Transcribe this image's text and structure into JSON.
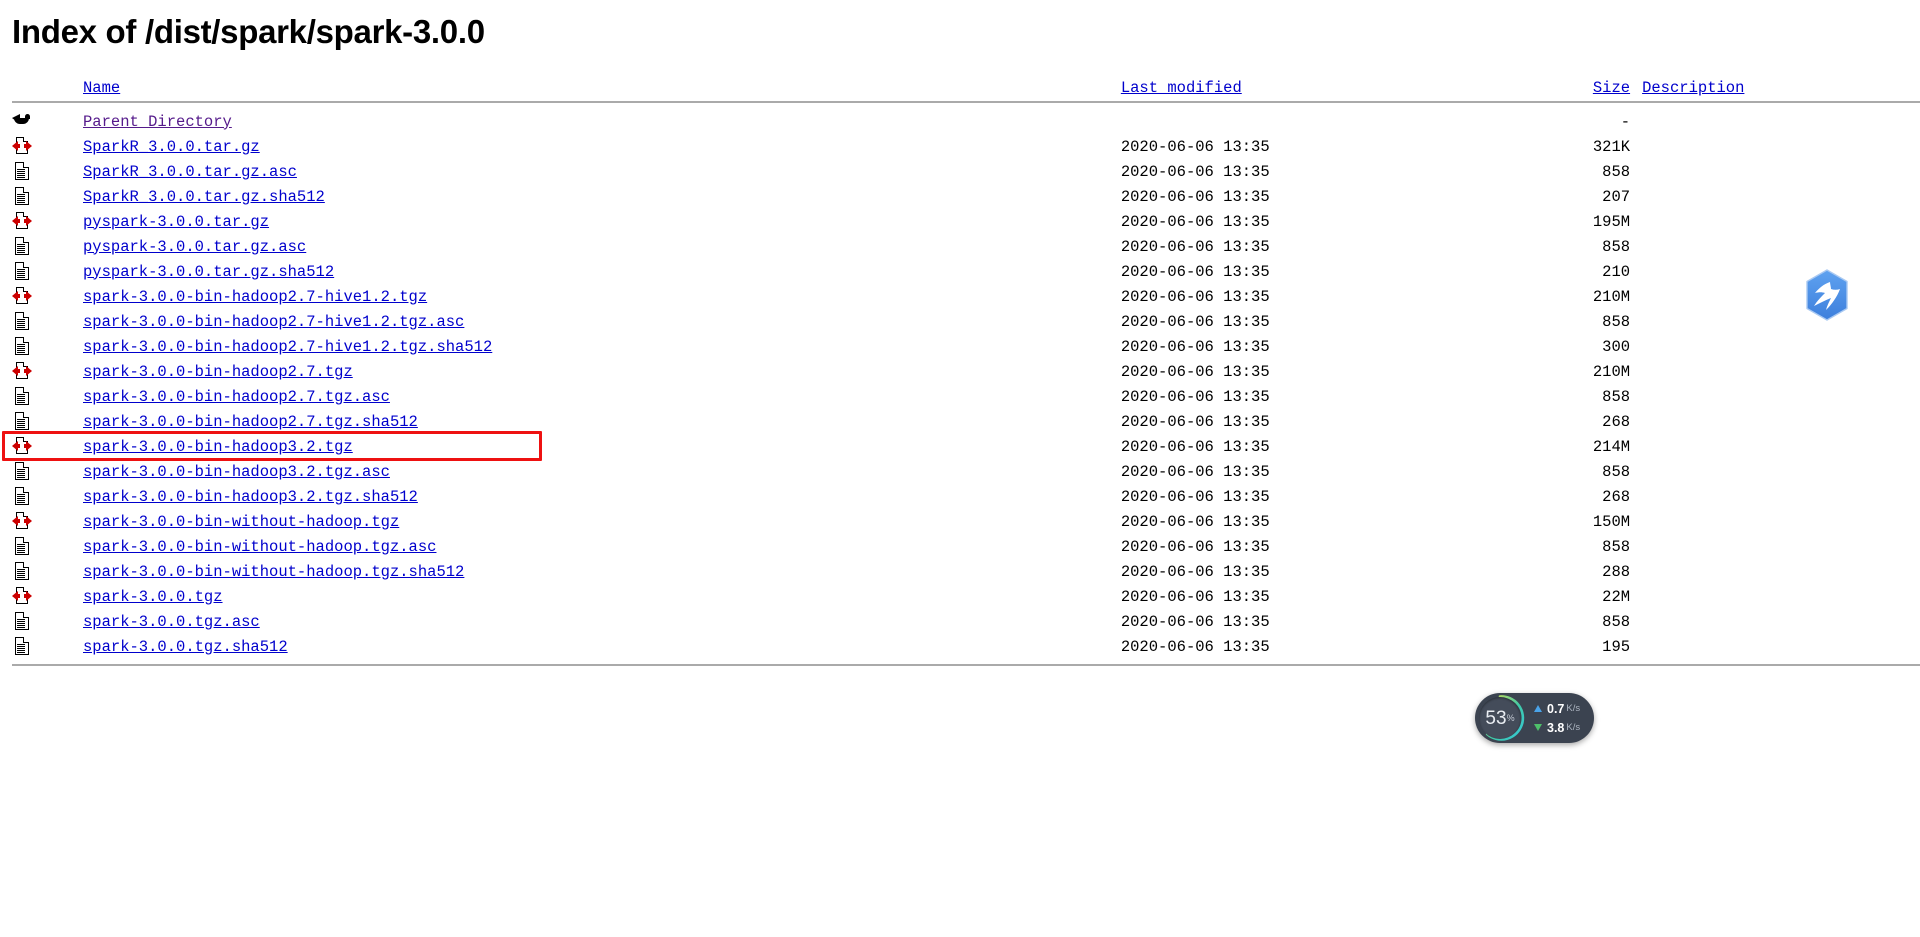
{
  "page": {
    "title": "Index of /dist/spark/spark-3.0.0"
  },
  "columns": {
    "name": "Name",
    "last_modified": "Last modified",
    "size": "Size",
    "description": "Description"
  },
  "parent": {
    "icon": "back-arrow-icon",
    "label": "Parent Directory",
    "last_modified": "",
    "size": "-",
    "description": ""
  },
  "rows": [
    {
      "icon": "archive-icon",
      "name": "SparkR_3.0.0.tar.gz",
      "last_modified": "2020-06-06 13:35",
      "size": "321K",
      "description": ""
    },
    {
      "icon": "text-file-icon",
      "name": "SparkR_3.0.0.tar.gz.asc",
      "last_modified": "2020-06-06 13:35",
      "size": "858",
      "description": ""
    },
    {
      "icon": "text-file-icon",
      "name": "SparkR_3.0.0.tar.gz.sha512",
      "last_modified": "2020-06-06 13:35",
      "size": "207",
      "description": ""
    },
    {
      "icon": "archive-icon",
      "name": "pyspark-3.0.0.tar.gz",
      "last_modified": "2020-06-06 13:35",
      "size": "195M",
      "description": ""
    },
    {
      "icon": "text-file-icon",
      "name": "pyspark-3.0.0.tar.gz.asc",
      "last_modified": "2020-06-06 13:35",
      "size": "858",
      "description": ""
    },
    {
      "icon": "text-file-icon",
      "name": "pyspark-3.0.0.tar.gz.sha512",
      "last_modified": "2020-06-06 13:35",
      "size": "210",
      "description": ""
    },
    {
      "icon": "archive-icon",
      "name": "spark-3.0.0-bin-hadoop2.7-hive1.2.tgz",
      "last_modified": "2020-06-06 13:35",
      "size": "210M",
      "description": ""
    },
    {
      "icon": "text-file-icon",
      "name": "spark-3.0.0-bin-hadoop2.7-hive1.2.tgz.asc",
      "last_modified": "2020-06-06 13:35",
      "size": "858",
      "description": ""
    },
    {
      "icon": "text-file-icon",
      "name": "spark-3.0.0-bin-hadoop2.7-hive1.2.tgz.sha512",
      "last_modified": "2020-06-06 13:35",
      "size": "300",
      "description": ""
    },
    {
      "icon": "archive-icon",
      "name": "spark-3.0.0-bin-hadoop2.7.tgz",
      "last_modified": "2020-06-06 13:35",
      "size": "210M",
      "description": ""
    },
    {
      "icon": "text-file-icon",
      "name": "spark-3.0.0-bin-hadoop2.7.tgz.asc",
      "last_modified": "2020-06-06 13:35",
      "size": "858",
      "description": ""
    },
    {
      "icon": "text-file-icon",
      "name": "spark-3.0.0-bin-hadoop2.7.tgz.sha512",
      "last_modified": "2020-06-06 13:35",
      "size": "268",
      "description": ""
    },
    {
      "icon": "archive-icon",
      "name": "spark-3.0.0-bin-hadoop3.2.tgz",
      "last_modified": "2020-06-06 13:35",
      "size": "214M",
      "description": "",
      "highlighted": true
    },
    {
      "icon": "text-file-icon",
      "name": "spark-3.0.0-bin-hadoop3.2.tgz.asc",
      "last_modified": "2020-06-06 13:35",
      "size": "858",
      "description": ""
    },
    {
      "icon": "text-file-icon",
      "name": "spark-3.0.0-bin-hadoop3.2.tgz.sha512",
      "last_modified": "2020-06-06 13:35",
      "size": "268",
      "description": ""
    },
    {
      "icon": "archive-icon",
      "name": "spark-3.0.0-bin-without-hadoop.tgz",
      "last_modified": "2020-06-06 13:35",
      "size": "150M",
      "description": ""
    },
    {
      "icon": "text-file-icon",
      "name": "spark-3.0.0-bin-without-hadoop.tgz.asc",
      "last_modified": "2020-06-06 13:35",
      "size": "858",
      "description": ""
    },
    {
      "icon": "text-file-icon",
      "name": "spark-3.0.0-bin-without-hadoop.tgz.sha512",
      "last_modified": "2020-06-06 13:35",
      "size": "288",
      "description": ""
    },
    {
      "icon": "archive-icon",
      "name": "spark-3.0.0.tgz",
      "last_modified": "2020-06-06 13:35",
      "size": "22M",
      "description": ""
    },
    {
      "icon": "text-file-icon",
      "name": "spark-3.0.0.tgz.asc",
      "last_modified": "2020-06-06 13:35",
      "size": "858",
      "description": ""
    },
    {
      "icon": "text-file-icon",
      "name": "spark-3.0.0.tgz.sha512",
      "last_modified": "2020-06-06 13:35",
      "size": "195",
      "description": ""
    }
  ],
  "floating_icon": {
    "name": "thunder-download-icon",
    "color": "#4a90e8"
  },
  "net_widget": {
    "cpu_percent": "53",
    "percent_symbol": "%",
    "upload_value": "0.7",
    "upload_unit": "K/s",
    "download_value": "3.8",
    "download_unit": "K/s",
    "background": "#3b4350",
    "upload_color": "#4aa3e8",
    "download_color": "#4ec06a"
  },
  "annotation": {
    "highlight_color": "#ee1111"
  }
}
